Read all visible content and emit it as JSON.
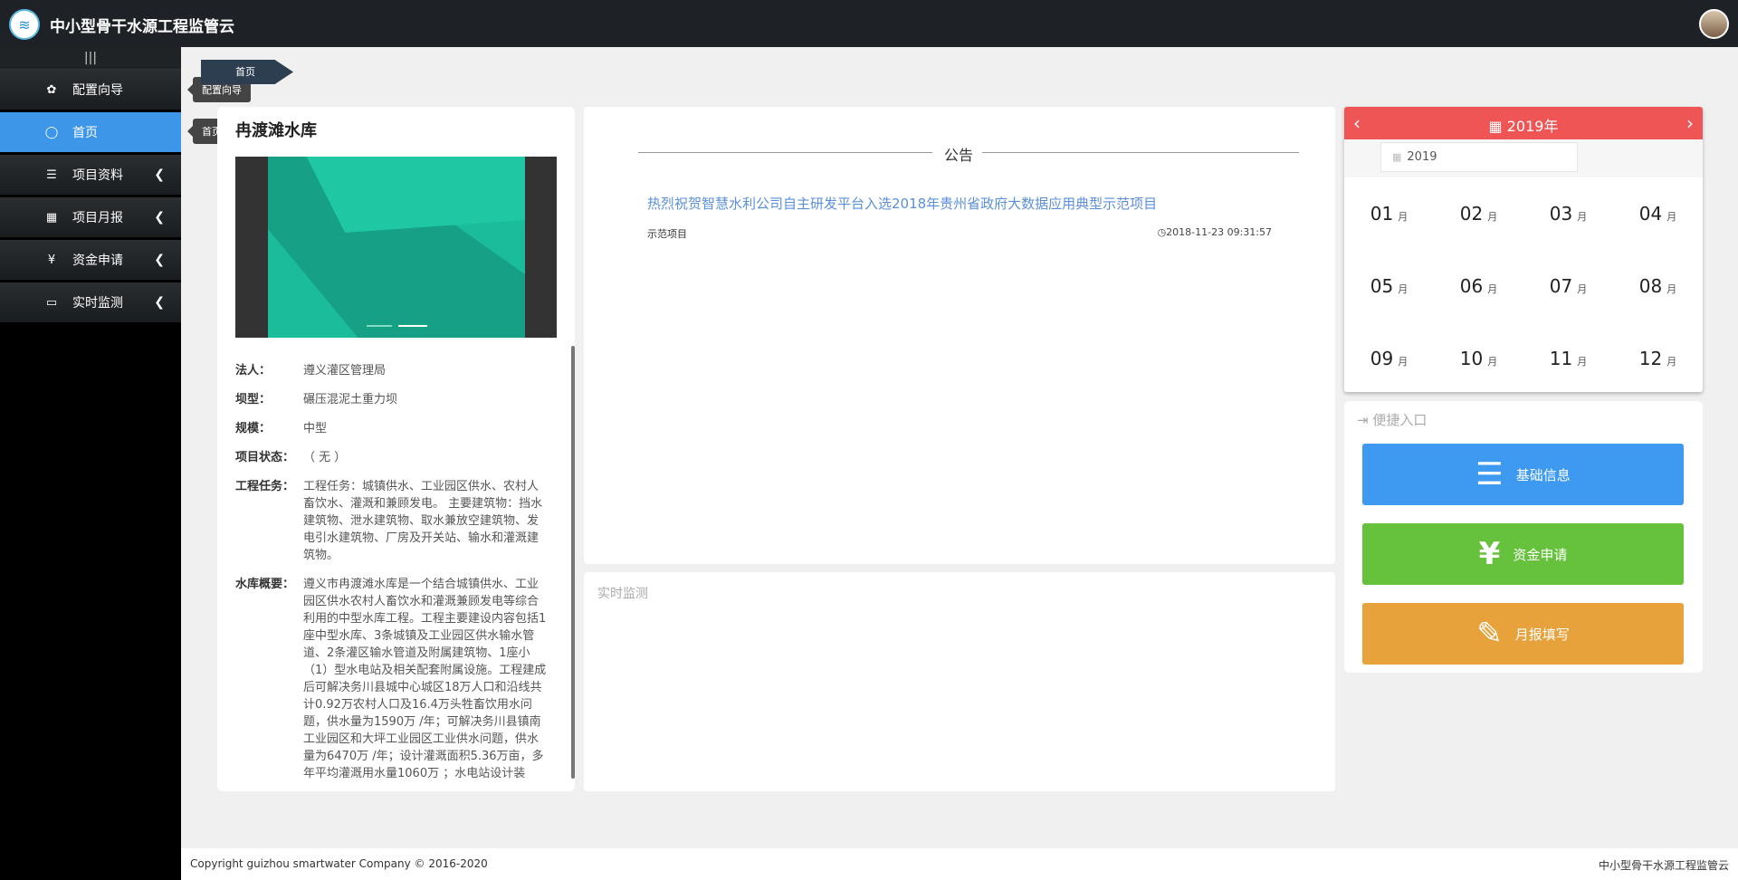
{
  "header": {
    "app_title": "中小型骨干水源工程监管云",
    "logo_icon": "logo-icon",
    "avatar": "user-avatar"
  },
  "sidebar": {
    "toggle": "|||",
    "items": [
      {
        "label": "配置向导",
        "icon": "gear-icon",
        "glyph": "✿",
        "active": false,
        "has_chevron": false
      },
      {
        "label": "首页",
        "icon": "circle-icon",
        "glyph": "◯",
        "active": true,
        "has_chevron": false
      },
      {
        "label": "项目资料",
        "icon": "list-icon",
        "glyph": "☰",
        "active": false,
        "has_chevron": true
      },
      {
        "label": "项目月报",
        "icon": "table-icon",
        "glyph": "▦",
        "active": false,
        "has_chevron": true
      },
      {
        "label": "资金申请",
        "icon": "yen-icon",
        "glyph": "¥",
        "active": false,
        "has_chevron": true
      },
      {
        "label": "实时监测",
        "icon": "laptop-icon",
        "glyph": "▭",
        "active": false,
        "has_chevron": true
      }
    ],
    "tooltips": [
      "配置向导",
      "首页"
    ]
  },
  "breadcrumb": {
    "label": "首页"
  },
  "project": {
    "title": "冉渡滩水库",
    "fields": [
      {
        "key": "法人：",
        "value": "遵义灌区管理局"
      },
      {
        "key": "坝型：",
        "value": "碾压混泥土重力坝"
      },
      {
        "key": "规模：",
        "value": "中型"
      },
      {
        "key": "项目状态：",
        "value": "（ 无 ）"
      },
      {
        "key": "工程任务：",
        "value": "工程任务：城镇供水、工业园区供水、农村人畜饮水、灌溉和兼顾发电。 主要建筑物：挡水建筑物、泄水建筑物、取水兼放空建筑物、发电引水建筑物、厂房及开关站、输水和灌溉建筑物。"
      },
      {
        "key": "水库概要：",
        "value": "遵义市冉渡滩水库是一个结合城镇供水、工业园区供水农村人畜饮水和灌溉兼顾发电等综合利用的中型水库工程。工程主要建设内容包括1座中型水库、3条城镇及工业园区供水输水管道、2条灌区输水管道及附属建筑物、1座小（1）型水电站及相关配套附属设施。工程建成后可解决务川县城中心城区18万人口和沿线共计0.92万农村人口及16.4万头牲畜饮用水问题，供水量为1590万 /年；可解决务川县镇南工业园区和大坪工业园区工业供水问题，供水量为6470万 /年；设计灌溉面积5.36万亩，多年平均灌溉用水量1060万 ；水电站设计装"
      }
    ]
  },
  "notice": {
    "heading": "公告",
    "title": "热烈祝贺智慧水利公司自主研发平台入选2018年贵州省政府大数据应用典型示范项目",
    "tag": "示范项目",
    "time": "◷2018-11-23 09:31:57"
  },
  "realtime": {
    "title": "实时监测"
  },
  "calendar": {
    "title": "2019年",
    "prev": "‹",
    "next": "›",
    "input_value": "2019",
    "header_color": "#f05555",
    "months": [
      {
        "num": "01",
        "unit": "月"
      },
      {
        "num": "02",
        "unit": "月"
      },
      {
        "num": "03",
        "unit": "月"
      },
      {
        "num": "04",
        "unit": "月"
      },
      {
        "num": "05",
        "unit": "月"
      },
      {
        "num": "06",
        "unit": "月"
      },
      {
        "num": "07",
        "unit": "月"
      },
      {
        "num": "08",
        "unit": "月"
      },
      {
        "num": "09",
        "unit": "月"
      },
      {
        "num": "10",
        "unit": "月"
      },
      {
        "num": "11",
        "unit": "月"
      },
      {
        "num": "12",
        "unit": "月"
      }
    ]
  },
  "quick": {
    "title": "便捷入口",
    "buttons": [
      {
        "label": "基础信息",
        "icon": "database-icon",
        "glyph": "☰",
        "color": "#3d9af0"
      },
      {
        "label": "资金申请",
        "icon": "yen-icon",
        "glyph": "¥",
        "color": "#66c13c"
      },
      {
        "label": "月报填写",
        "icon": "edit-icon",
        "glyph": "✎",
        "color": "#e8a23c"
      }
    ]
  },
  "footer": {
    "copyright": "Copyright guizhou smartwater Company © 2016-2020",
    "brand": "中小型骨干水源工程监管云"
  }
}
